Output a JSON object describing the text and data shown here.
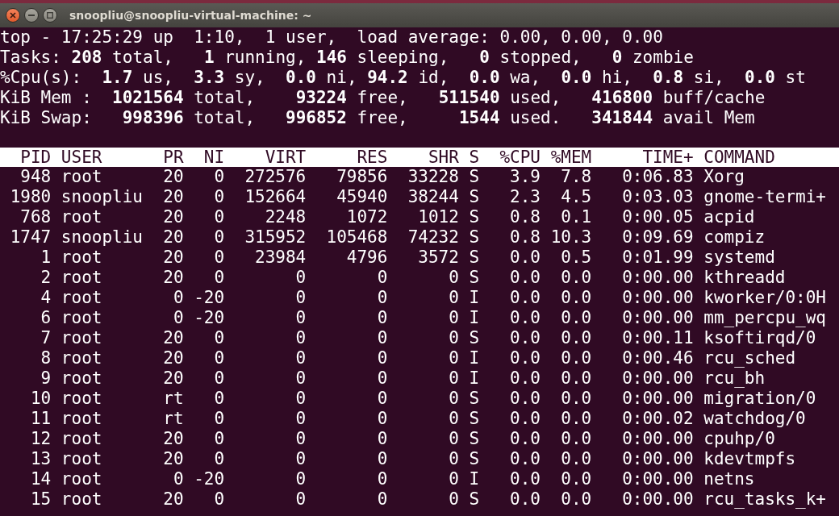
{
  "window": {
    "title": "snoopliu@snoopliu-virtual-machine: ~"
  },
  "summary": [
    "top - 17:25:29 up  1:10,  1 user,  load average: 0.00, 0.00, 0.00",
    "Tasks: **208** total,   **1** running, **146** sleeping,   **0** stopped,   **0** zombie",
    "%Cpu(s):  **1.7** us,  **3.3** sy,  **0.0** ni, **94.2** id,  **0.0** wa,  **0.0** hi,  **0.8** si,  **0.0** st",
    "KiB Mem :  **1021564** total,    **93224** free,   **511540** used,   **416800** buff/cache",
    "KiB Swap:   **998396** total,   **996852** free,     **1544** used.   **341844** avail Mem"
  ],
  "table": {
    "columns": [
      "PID",
      "USER",
      "PR",
      "NI",
      "VIRT",
      "RES",
      "SHR",
      "S",
      "%CPU",
      "%MEM",
      "TIME+",
      "COMMAND"
    ],
    "rows": [
      [
        "948",
        "root",
        "20",
        "0",
        "272576",
        "79856",
        "33228",
        "S",
        "3.9",
        "7.8",
        "0:06.83",
        "Xorg"
      ],
      [
        "1980",
        "snoopliu",
        "20",
        "0",
        "152664",
        "45940",
        "38244",
        "S",
        "2.3",
        "4.5",
        "0:03.03",
        "gnome-termi+"
      ],
      [
        "768",
        "root",
        "20",
        "0",
        "2248",
        "1072",
        "1012",
        "S",
        "0.8",
        "0.1",
        "0:00.05",
        "acpid"
      ],
      [
        "1747",
        "snoopliu",
        "20",
        "0",
        "315952",
        "105468",
        "74232",
        "S",
        "0.8",
        "10.3",
        "0:09.69",
        "compiz"
      ],
      [
        "1",
        "root",
        "20",
        "0",
        "23984",
        "4796",
        "3572",
        "S",
        "0.0",
        "0.5",
        "0:01.99",
        "systemd"
      ],
      [
        "2",
        "root",
        "20",
        "0",
        "0",
        "0",
        "0",
        "S",
        "0.0",
        "0.0",
        "0:00.00",
        "kthreadd"
      ],
      [
        "4",
        "root",
        "0",
        "-20",
        "0",
        "0",
        "0",
        "I",
        "0.0",
        "0.0",
        "0:00.00",
        "kworker/0:0H"
      ],
      [
        "6",
        "root",
        "0",
        "-20",
        "0",
        "0",
        "0",
        "I",
        "0.0",
        "0.0",
        "0:00.00",
        "mm_percpu_wq"
      ],
      [
        "7",
        "root",
        "20",
        "0",
        "0",
        "0",
        "0",
        "S",
        "0.0",
        "0.0",
        "0:00.11",
        "ksoftirqd/0"
      ],
      [
        "8",
        "root",
        "20",
        "0",
        "0",
        "0",
        "0",
        "I",
        "0.0",
        "0.0",
        "0:00.46",
        "rcu_sched"
      ],
      [
        "9",
        "root",
        "20",
        "0",
        "0",
        "0",
        "0",
        "I",
        "0.0",
        "0.0",
        "0:00.00",
        "rcu_bh"
      ],
      [
        "10",
        "root",
        "rt",
        "0",
        "0",
        "0",
        "0",
        "S",
        "0.0",
        "0.0",
        "0:00.00",
        "migration/0"
      ],
      [
        "11",
        "root",
        "rt",
        "0",
        "0",
        "0",
        "0",
        "S",
        "0.0",
        "0.0",
        "0:00.02",
        "watchdog/0"
      ],
      [
        "12",
        "root",
        "20",
        "0",
        "0",
        "0",
        "0",
        "S",
        "0.0",
        "0.0",
        "0:00.00",
        "cpuhp/0"
      ],
      [
        "13",
        "root",
        "20",
        "0",
        "0",
        "0",
        "0",
        "S",
        "0.0",
        "0.0",
        "0:00.00",
        "kdevtmpfs"
      ],
      [
        "14",
        "root",
        "0",
        "-20",
        "0",
        "0",
        "0",
        "I",
        "0.0",
        "0.0",
        "0:00.00",
        "netns"
      ],
      [
        "15",
        "root",
        "20",
        "0",
        "0",
        "0",
        "0",
        "S",
        "0.0",
        "0.0",
        "0:00.00",
        "rcu_tasks_k+"
      ]
    ]
  }
}
